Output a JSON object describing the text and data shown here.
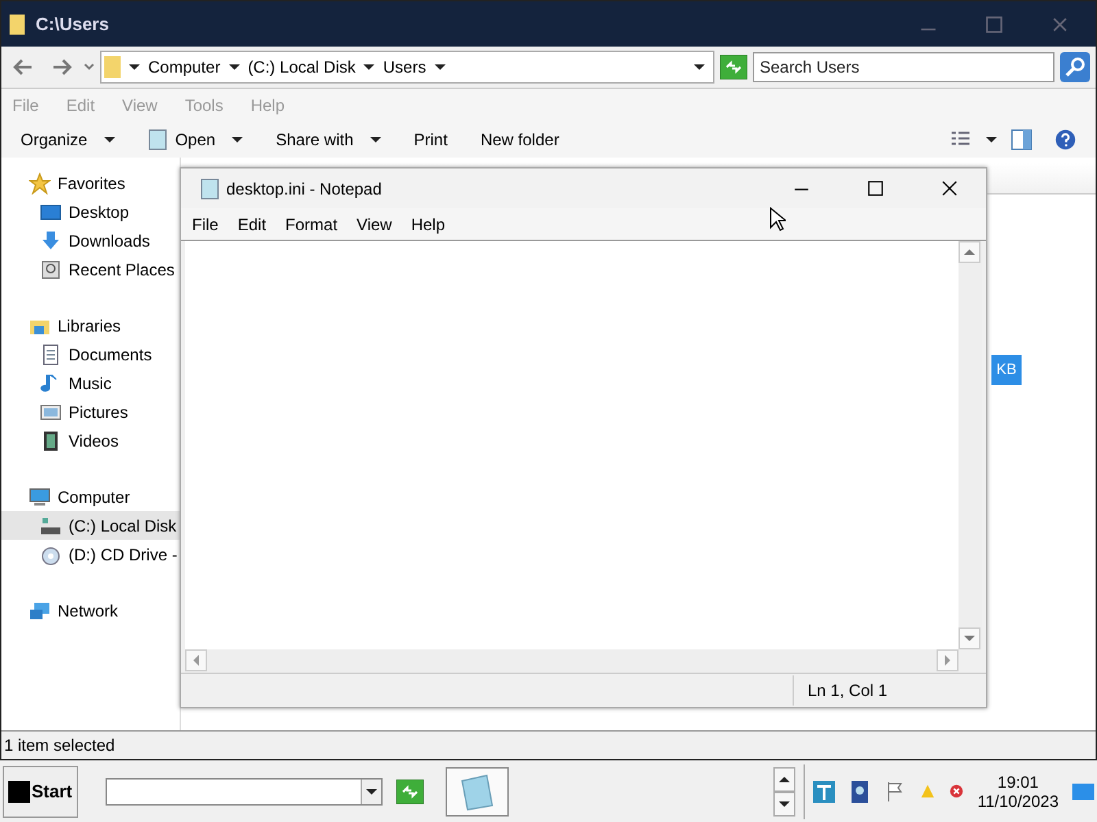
{
  "window": {
    "title": "C:\\Users"
  },
  "address": {
    "crumbs": [
      "Computer",
      "(C:) Local Disk",
      "Users"
    ],
    "search_placeholder": "Search Users"
  },
  "menu": [
    "File",
    "Edit",
    "View",
    "Tools",
    "Help"
  ],
  "toolbar": [
    {
      "label": "Organize",
      "dropdown": true,
      "has_icon": false
    },
    {
      "label": "Open",
      "dropdown": true,
      "has_icon": true
    },
    {
      "label": "Share with",
      "dropdown": true,
      "has_icon": false
    },
    {
      "label": "Print",
      "dropdown": false,
      "has_icon": false
    },
    {
      "label": "New folder",
      "dropdown": false,
      "has_icon": false
    }
  ],
  "nav": [
    {
      "label": "Favorites",
      "kind": "star",
      "children": [
        {
          "label": "Desktop",
          "kind": "desktop",
          "selected": false
        },
        {
          "label": "Downloads",
          "kind": "download",
          "selected": false
        },
        {
          "label": "Recent Places",
          "kind": "recent",
          "selected": false
        }
      ]
    },
    {
      "label": "Libraries",
      "kind": "library",
      "children": [
        {
          "label": "Documents",
          "kind": "document",
          "selected": false
        },
        {
          "label": "Music",
          "kind": "music",
          "selected": false
        },
        {
          "label": "Pictures",
          "kind": "picture",
          "selected": false
        },
        {
          "label": "Videos",
          "kind": "video",
          "selected": false
        }
      ]
    },
    {
      "label": "Computer",
      "kind": "computer",
      "children": [
        {
          "label": "(C:) Local Disk",
          "kind": "disk",
          "selected": true
        },
        {
          "label": "(D:) CD Drive -",
          "kind": "cd",
          "selected": false
        }
      ]
    },
    {
      "label": "Network",
      "kind": "network"
    }
  ],
  "status_bar": "1 item selected",
  "badge": "KB",
  "notepad": {
    "title": "desktop.ini - Notepad",
    "menu": [
      "File",
      "Edit",
      "Format",
      "View",
      "Help"
    ],
    "status": "Ln 1, Col 1"
  },
  "taskbar": {
    "start": "Start",
    "time": "19:01",
    "date": "11/10/2023"
  }
}
